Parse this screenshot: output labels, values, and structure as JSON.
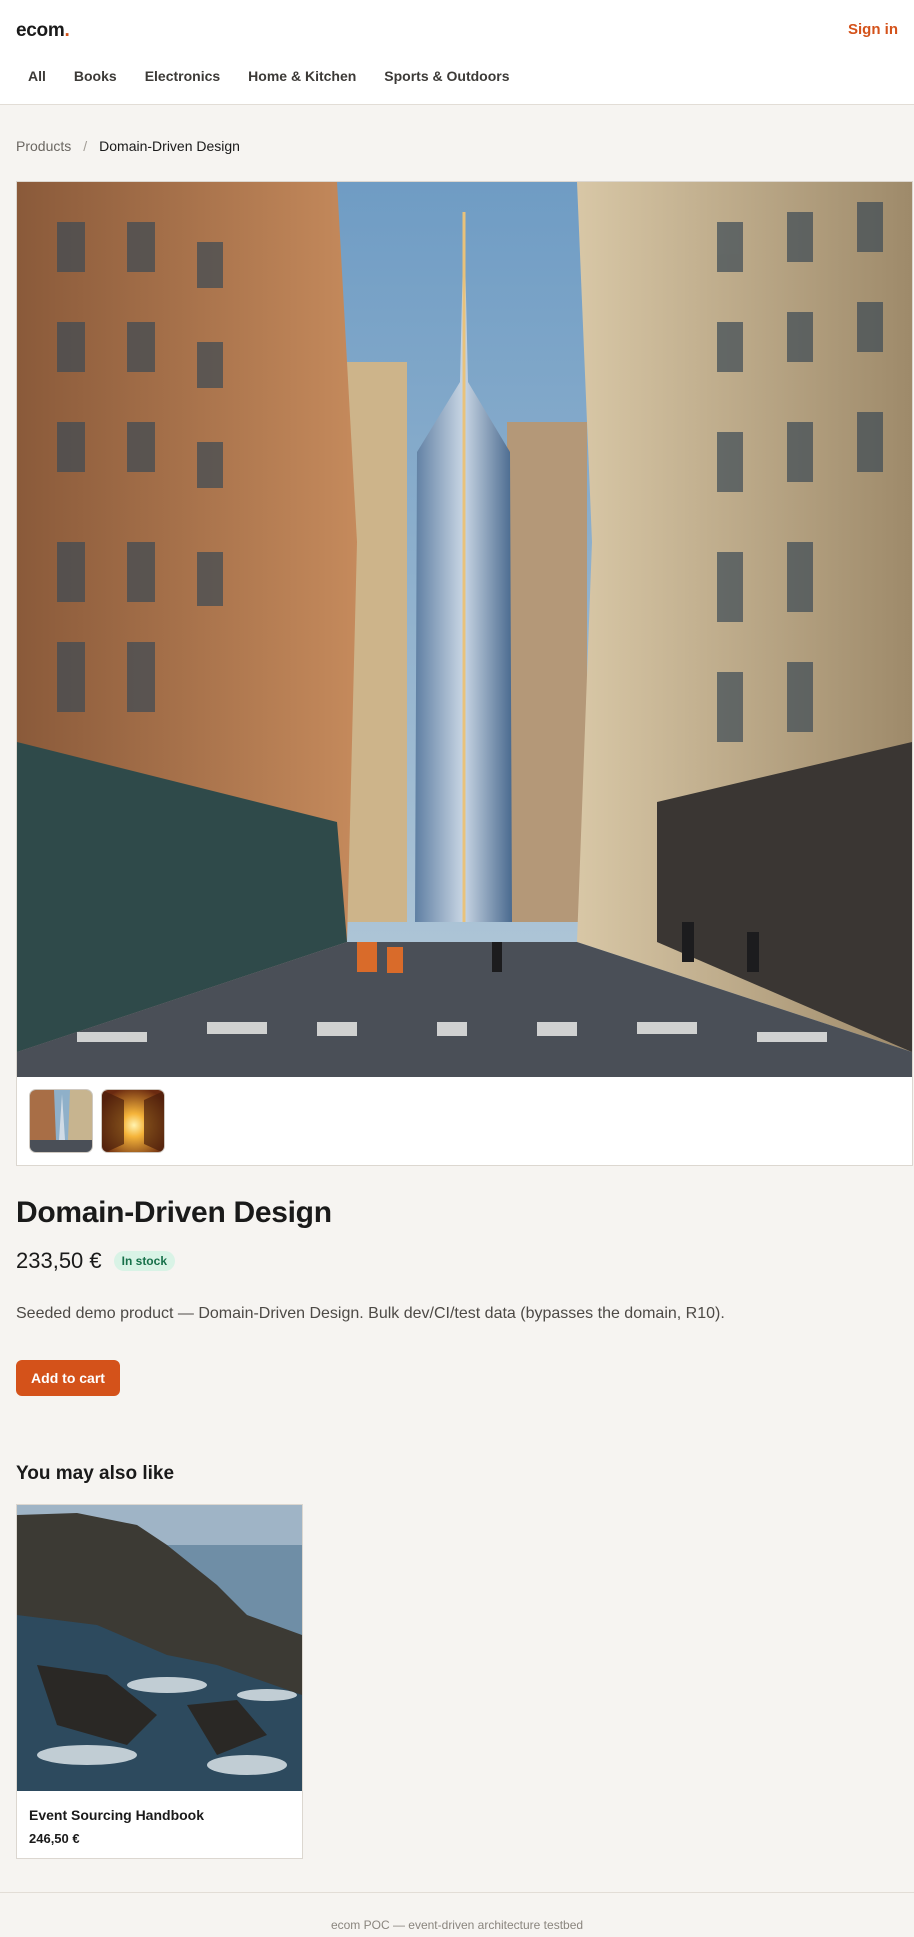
{
  "header": {
    "brand": "ecom",
    "brand_dot": ".",
    "signin": "Sign in",
    "nav": [
      "All",
      "Books",
      "Electronics",
      "Home & Kitchen",
      "Sports & Outdoors"
    ]
  },
  "breadcrumb": {
    "root": "Products",
    "separator": "/",
    "current": "Domain-Driven Design"
  },
  "product": {
    "title": "Domain-Driven Design",
    "price": "233,50 €",
    "stock_badge": "In stock",
    "description": "Seeded demo product — Domain-Driven Design. Bulk dev/CI/test data (bypasses the domain, R10).",
    "add_to_cart": "Add to cart",
    "images": [
      "city-street-skyscraper-photo",
      "sunset-street-photo"
    ]
  },
  "related": {
    "heading": "You may also like",
    "items": [
      {
        "name": "Event Sourcing Handbook",
        "price": "246,50 €",
        "image": "rocky-coast-photo"
      }
    ]
  },
  "footer": {
    "text": "ecom POC — event-driven architecture testbed"
  },
  "colors": {
    "accent": "#d4521a",
    "background": "#f6f4f1",
    "stock_bg": "#d9f3e6",
    "stock_fg": "#17704a"
  }
}
